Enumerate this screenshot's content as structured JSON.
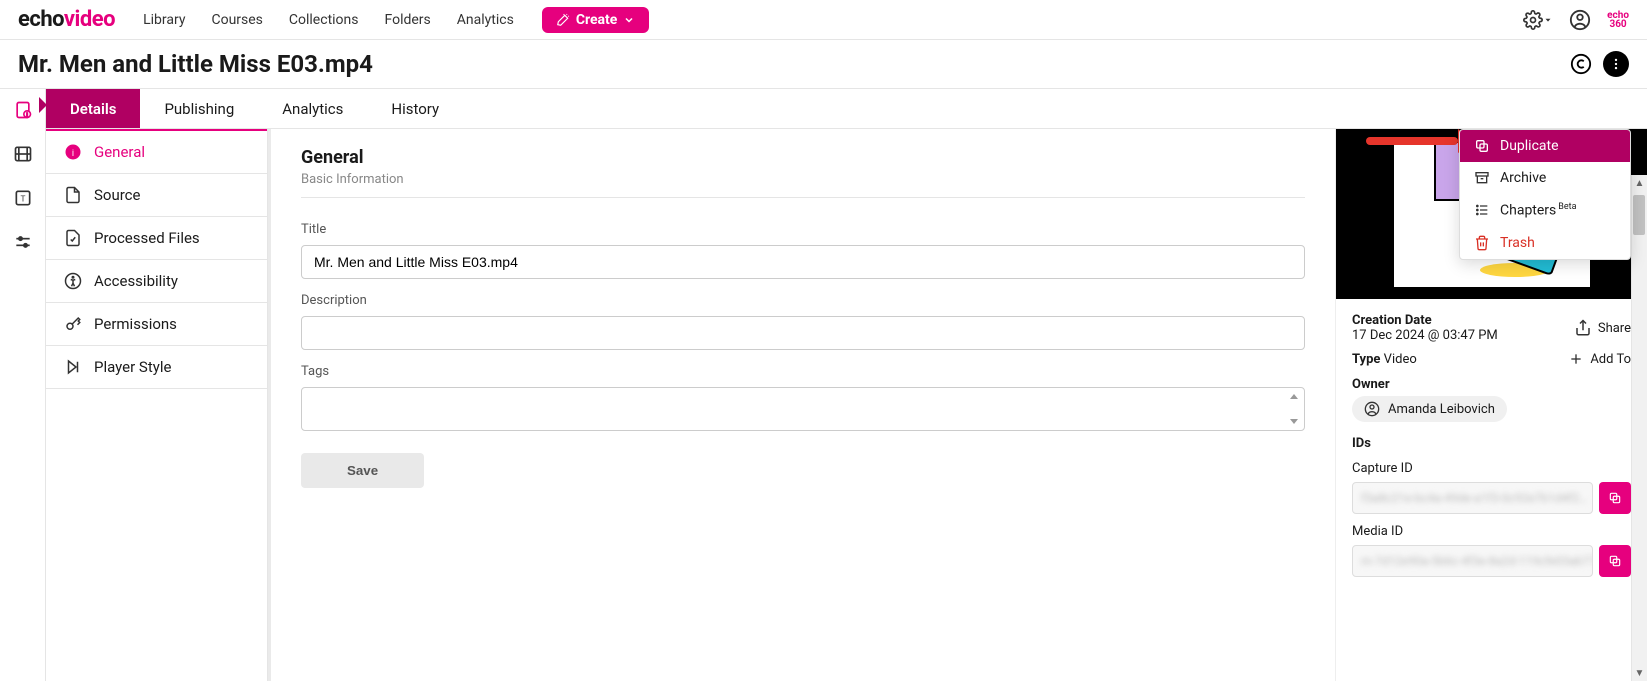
{
  "brand": {
    "prefix": "echo",
    "suffix": "video",
    "mini": "echo\n360"
  },
  "nav": {
    "library": "Library",
    "courses": "Courses",
    "collections": "Collections",
    "folders": "Folders",
    "analytics": "Analytics",
    "create": "Create"
  },
  "page_title": "Mr. Men and Little Miss E03.mp4",
  "tabs": {
    "details": "Details",
    "publishing": "Publishing",
    "analytics": "Analytics",
    "history": "History"
  },
  "subnav": {
    "general": "General",
    "source": "Source",
    "processed": "Processed Files",
    "accessibility": "Accessibility",
    "permissions": "Permissions",
    "player": "Player Style"
  },
  "form": {
    "heading": "General",
    "sub": "Basic Information",
    "title_label": "Title",
    "title_value": "Mr. Men and Little Miss E03.mp4",
    "desc_label": "Description",
    "desc_value": "",
    "tags_label": "Tags",
    "save": "Save"
  },
  "meta": {
    "creation_label": "Creation Date",
    "creation_value": "17 Dec 2024 @ 03:47 PM",
    "share": "Share",
    "type_label": "Type",
    "type_value": "Video",
    "addto": "Add To",
    "owner_label": "Owner",
    "owner_name": "Amanda Leibovich",
    "ids_label": "IDs",
    "capture_label": "Capture ID",
    "media_label": "Media ID",
    "capture_value": "f3a8c21e-bc4a-49de-a1f3-0c92e7b1d4f2…",
    "media_value": "m-7d12e90a-5b6c-4f3e-8a2d-119cfe03ab77…"
  },
  "menu": {
    "duplicate": "Duplicate",
    "archive": "Archive",
    "chapters": "Chapters",
    "chapters_badge": "Beta",
    "trash": "Trash"
  }
}
